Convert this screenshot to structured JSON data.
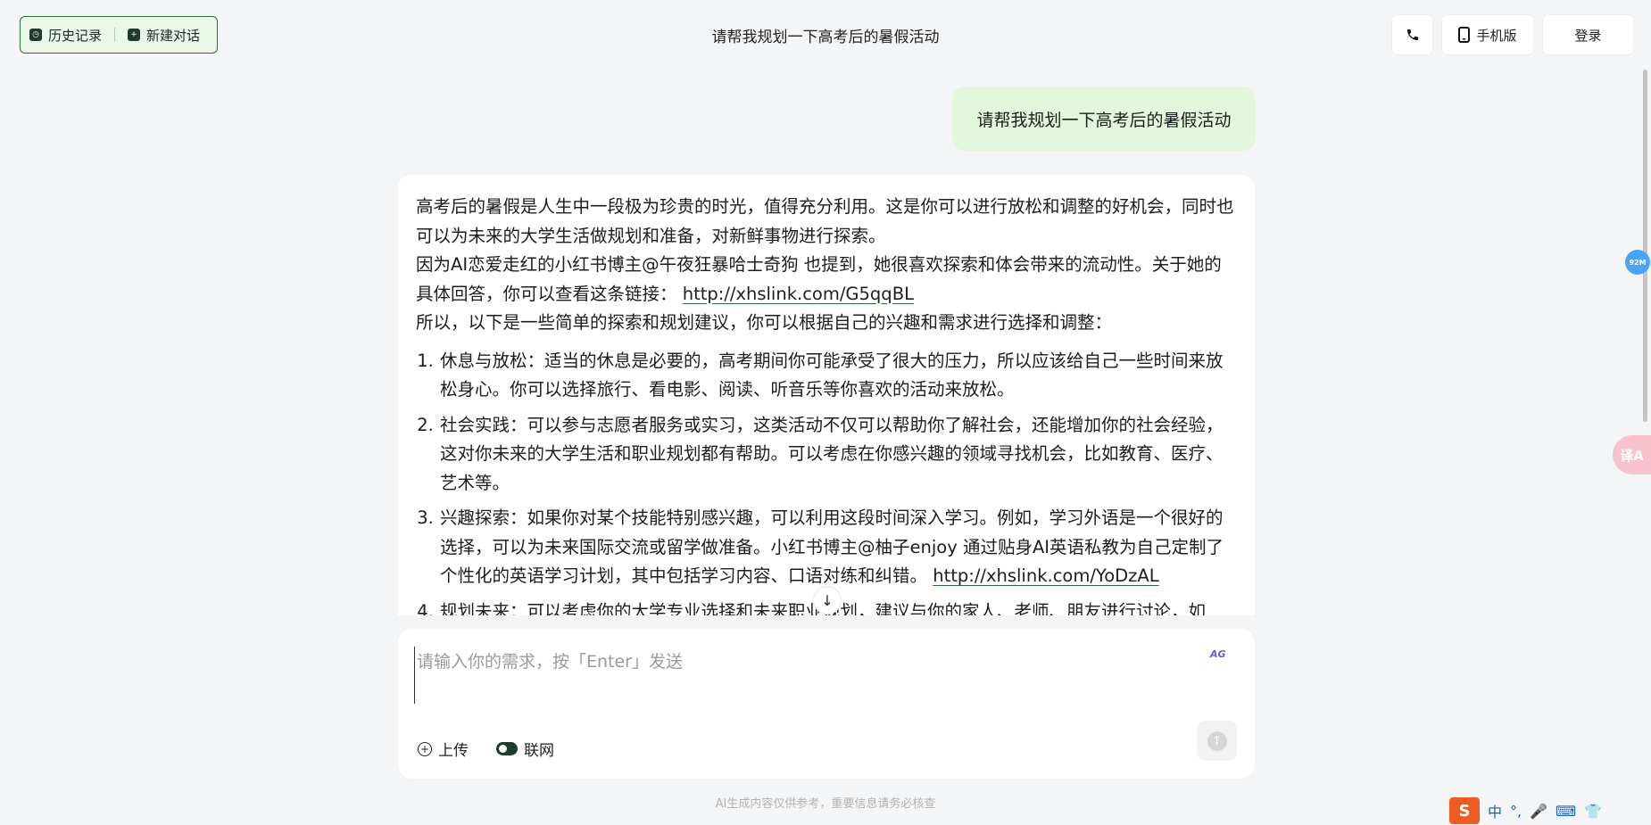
{
  "header": {
    "history_label": "历史记录",
    "new_chat_label": "新建对话",
    "title": "请帮我规划一下高考后的暑假活动",
    "mobile_label": "手机版",
    "login_label": "登录"
  },
  "chat": {
    "user_message": "请帮我规划一下高考后的暑假活动",
    "answer": {
      "para1": "高考后的暑假是人生中一段极为珍贵的时光，值得充分利用。这是你可以进行放松和调整的好机会，同时也可以为未来的大学生活做规划和准备，对新鲜事物进行探索。",
      "para2_text": "因为AI恋爱走红的小红书博主@午夜狂暴哈士奇狗 也提到，她很喜欢探索和体会带来的流动性。关于她的具体回答，你可以查看这条链接：",
      "para2_link": "http://xhslink.com/G5qqBL",
      "para3": "所以，以下是一些简单的探索和规划建议，你可以根据自己的兴趣和需求进行选择和调整：",
      "items": [
        {
          "text": "休息与放松：适当的休息是必要的，高考期间你可能承受了很大的压力，所以应该给自己一些时间来放松身心。你可以选择旅行、看电影、阅读、听音乐等你喜欢的活动来放松。"
        },
        {
          "text": "社会实践：可以参与志愿者服务或实习，这类活动不仅可以帮助你了解社会，还能增加你的社会经验，这对你未来的大学生活和职业规划都有帮助。可以考虑在你感兴趣的领域寻找机会，比如教育、医疗、艺术等。"
        },
        {
          "text": "兴趣探索：如果你对某个技能特别感兴趣，可以利用这段时间深入学习。例如，学习外语是一个很好的选择，可以为未来国际交流或留学做准备。小红书博主@柚子enjoy 通过贴身AI英语私教为自己定制了个性化的英语学习计划，其中包括学习内容、口语对练和纠错。",
          "link": "http://xhslink.com/YoDzAL"
        },
        {
          "text": "规划未来：可以考虑你的大学专业选择和未来职业规划，建议与你的家人、老师、朋友进行讨论，如"
        }
      ]
    }
  },
  "input": {
    "placeholder": "请输入你的需求，按「Enter」发送",
    "upload_label": "上传",
    "web_label": "联网",
    "web_enabled": true
  },
  "footer": {
    "disclaimer": "AI生成内容仅供参考，重要信息请务必核查"
  },
  "widgets": {
    "memory_badge": "92M",
    "translate_glyph": "译A",
    "ime_logo": "S",
    "ime_mode": "中"
  },
  "colors": {
    "accent_green": "#2f6b3c",
    "user_bubble": "#e3f7dc",
    "background": "#f4f5f7"
  }
}
